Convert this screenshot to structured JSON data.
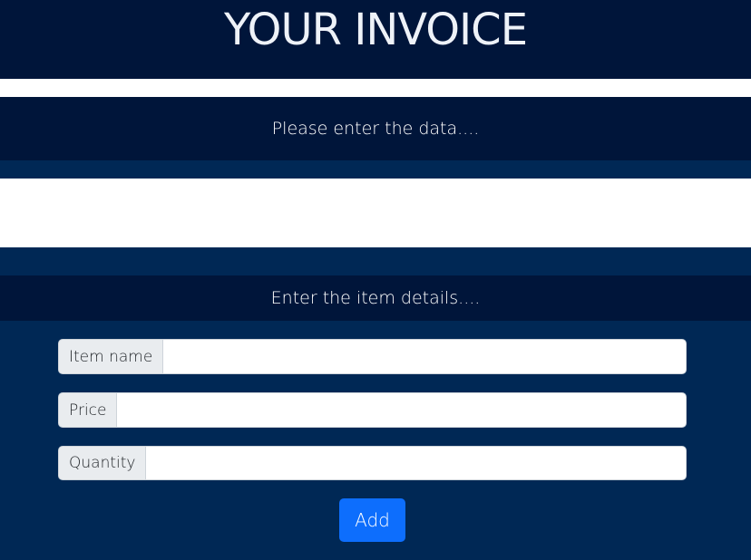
{
  "header": {
    "title": "YOUR INVOICE"
  },
  "data_section": {
    "prompt": "Please enter the data...."
  },
  "item_section": {
    "prompt": "Enter the item details....",
    "fields": [
      {
        "label": "Item name",
        "value": "",
        "placeholder": ""
      },
      {
        "label": "Price",
        "value": "",
        "placeholder": ""
      },
      {
        "label": "Quantity",
        "value": "",
        "placeholder": ""
      }
    ],
    "add_label": "Add"
  },
  "colors": {
    "header_bg": "#00153a",
    "page_bg": "#002855",
    "button_bg": "#0d6efd",
    "addon_bg": "#e9ecef"
  }
}
